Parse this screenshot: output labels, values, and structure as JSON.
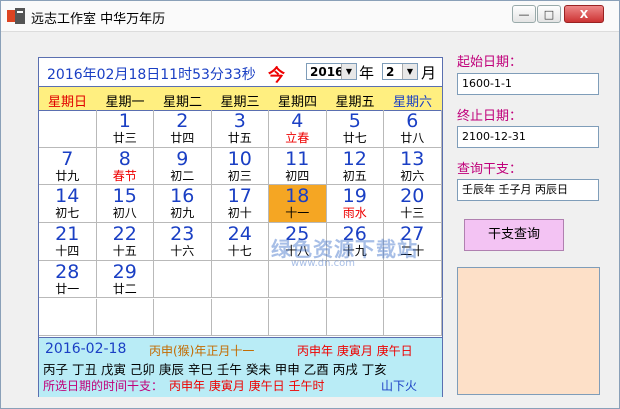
{
  "window": {
    "title": "远志工作室 中华万年历",
    "minimize": "—",
    "maximize": "□",
    "close": "X"
  },
  "header": {
    "datetime": "2016年02月18日11时53分33秒",
    "today_label": "今",
    "year_value": "2016",
    "year_unit": "年",
    "month_value": "2",
    "month_unit": "月"
  },
  "weekdays": [
    "星期日",
    "星期一",
    "星期二",
    "星期三",
    "星期四",
    "星期五",
    "星期六"
  ],
  "weekday_colors": [
    "#e00000",
    "#000000",
    "#000000",
    "#000000",
    "#000000",
    "#000000",
    "#1a3fc4"
  ],
  "days": [
    {
      "d": "1",
      "l": "廿三",
      "red": false
    },
    {
      "d": "2",
      "l": "廿四",
      "red": false
    },
    {
      "d": "3",
      "l": "廿五",
      "red": false
    },
    {
      "d": "4",
      "l": "立春",
      "red": true
    },
    {
      "d": "5",
      "l": "廿七",
      "red": false
    },
    {
      "d": "6",
      "l": "廿八",
      "red": false
    },
    {
      "d": "7",
      "l": "廿九",
      "red": false
    },
    {
      "d": "8",
      "l": "春节",
      "red": true
    },
    {
      "d": "9",
      "l": "初二",
      "red": false
    },
    {
      "d": "10",
      "l": "初三",
      "red": false
    },
    {
      "d": "11",
      "l": "初四",
      "red": false
    },
    {
      "d": "12",
      "l": "初五",
      "red": false
    },
    {
      "d": "13",
      "l": "初六",
      "red": false
    },
    {
      "d": "14",
      "l": "初七",
      "red": false
    },
    {
      "d": "15",
      "l": "初八",
      "red": false
    },
    {
      "d": "16",
      "l": "初九",
      "red": false
    },
    {
      "d": "17",
      "l": "初十",
      "red": false
    },
    {
      "d": "18",
      "l": "十一",
      "red": false,
      "today": true
    },
    {
      "d": "19",
      "l": "雨水",
      "red": true
    },
    {
      "d": "20",
      "l": "十三",
      "red": false
    },
    {
      "d": "21",
      "l": "十四",
      "red": false
    },
    {
      "d": "22",
      "l": "十五",
      "red": false
    },
    {
      "d": "23",
      "l": "十六",
      "red": false
    },
    {
      "d": "24",
      "l": "十七",
      "red": false
    },
    {
      "d": "25",
      "l": "十八",
      "red": false
    },
    {
      "d": "26",
      "l": "十九",
      "red": false
    },
    {
      "d": "27",
      "l": "二十",
      "red": false
    },
    {
      "d": "28",
      "l": "廿一",
      "red": false
    },
    {
      "d": "29",
      "l": "廿二",
      "red": false
    }
  ],
  "first_weekday": 1,
  "footer": {
    "date": "2016-02-18",
    "lunar": "丙申(猴)年正月十一",
    "ganzhi_ymd": "丙申年 庚寅月 庚午日",
    "hours": "丙子 丁丑 戊寅 己卯 庚辰 辛巳 壬午 癸未 甲申 乙酉 丙戌 丁亥",
    "selected_prefix": "所选日期的时间干支：",
    "selected_ganzhi": "丙申年 庚寅月 庚午日 壬午时",
    "nayin": "山下火"
  },
  "watermark": "绿色资源下载站",
  "watermark_url": "www.dn.com",
  "right_panel": {
    "start_label": "起始日期：",
    "start_value": "1600-1-1",
    "end_label": "终止日期：",
    "end_value": "2100-12-31",
    "query_label": "查询干支：",
    "query_value": "壬辰年 壬子月 丙辰日",
    "query_button": "干支查询"
  }
}
